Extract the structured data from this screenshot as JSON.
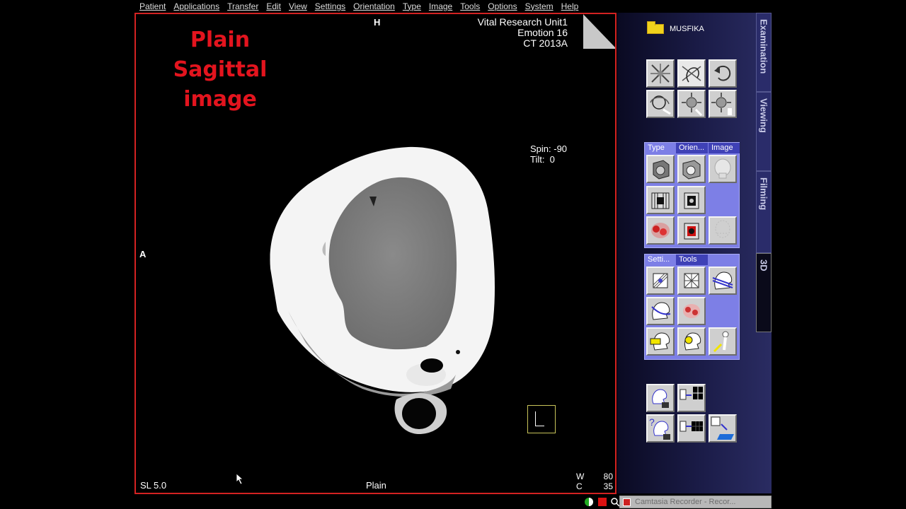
{
  "menu": [
    "Patient",
    "Applications",
    "Transfer",
    "Edit",
    "View",
    "Settings",
    "Orientation",
    "Type",
    "Image",
    "Tools",
    "Options",
    "System",
    "Help"
  ],
  "viewer": {
    "annotation_title": [
      "Plain Sagittal",
      "image"
    ],
    "top_marker": "H",
    "left_marker": "A",
    "institution": [
      "Vital Research Unit1",
      "Emotion 16",
      "CT 2013A"
    ],
    "spin_label": "Spin: -90",
    "tilt_label": "Tilt:  0",
    "slice_label": "SL 5.0",
    "recon_label": "Plain",
    "window_label": "W",
    "window_value": "80",
    "center_label": "C",
    "center_value": "35"
  },
  "panel": {
    "patient_folder": "MUSFIKA",
    "side_tabs": [
      "Examination",
      "Viewing",
      "Filming",
      "3D"
    ],
    "group1_tabs": [
      "Type",
      "Orien...",
      "Image"
    ],
    "group2_tabs": [
      "Setti...",
      "Tools"
    ]
  },
  "taskbar": {
    "recorder_title": "Camtasia Recorder - Recor..."
  },
  "colors": {
    "viewer_border": "#d32222",
    "annotation_red": "#e3141e",
    "group_bg": "#7d7fe6",
    "panel_bg": "#1b1c48"
  }
}
